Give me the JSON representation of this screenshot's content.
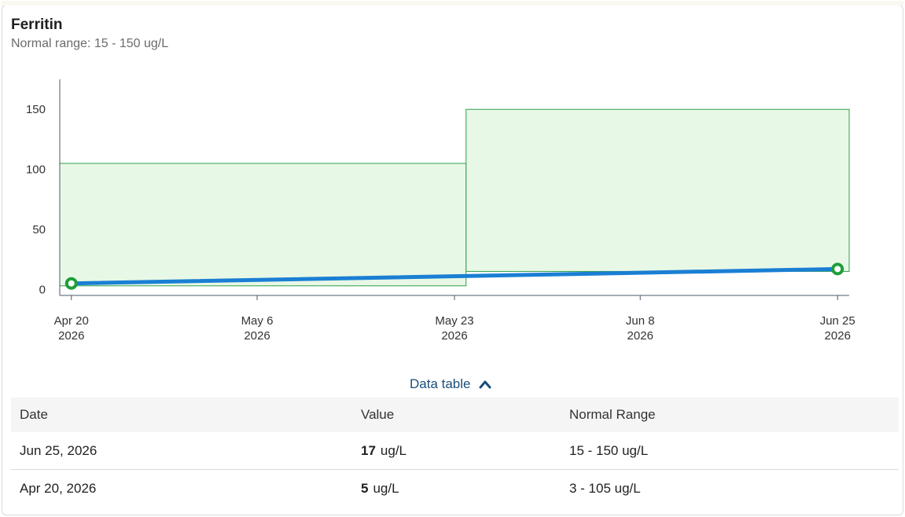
{
  "card": {
    "title": "Ferritin",
    "subtitle": "Normal range: 15 - 150 ug/L"
  },
  "chart_data": {
    "type": "line",
    "title": "Ferritin",
    "subtitle": "Normal range: 15 - 150 ug/L",
    "xlabel": "",
    "ylabel": "",
    "x_range": [
      "2026-04-19",
      "2026-06-26"
    ],
    "ylim": [
      -5,
      175
    ],
    "y_ticks": [
      0,
      50,
      100,
      150
    ],
    "x_ticks": [
      {
        "date": "2026-04-20",
        "line1": "Apr 20",
        "line2": "2026"
      },
      {
        "date": "2026-05-06",
        "line1": "May 6",
        "line2": "2026"
      },
      {
        "date": "2026-05-23",
        "line1": "May 23",
        "line2": "2026"
      },
      {
        "date": "2026-06-08",
        "line1": "Jun 8",
        "line2": "2026"
      },
      {
        "date": "2026-06-25",
        "line1": "Jun 25",
        "line2": "2026"
      }
    ],
    "series": [
      {
        "values": [
          {
            "date": "2026-04-20",
            "y": 5
          },
          {
            "date": "2026-06-25",
            "y": 17
          }
        ],
        "color": "#1a7fd4",
        "marker_color": "#1e9e3a"
      }
    ],
    "normal_range_bands": [
      {
        "from": "2026-04-19",
        "to": "2026-05-24",
        "low": 3,
        "high": 105
      },
      {
        "from": "2026-05-24",
        "to": "2026-06-26",
        "low": 15,
        "high": 150
      }
    ],
    "band_fill": "#e8f8e6",
    "band_stroke": "#2f9e4a",
    "grid": false,
    "legend": "none"
  },
  "data_table": {
    "toggle_label": "Data table",
    "headers": [
      "Date",
      "Value",
      "Normal Range"
    ],
    "rows": [
      {
        "date": "Jun 25, 2026",
        "value": "17",
        "unit": "ug/L",
        "range": "15 - 150 ug/L"
      },
      {
        "date": "Apr 20, 2026",
        "value": "5",
        "unit": "ug/L",
        "range": "3 - 105 ug/L"
      }
    ]
  }
}
